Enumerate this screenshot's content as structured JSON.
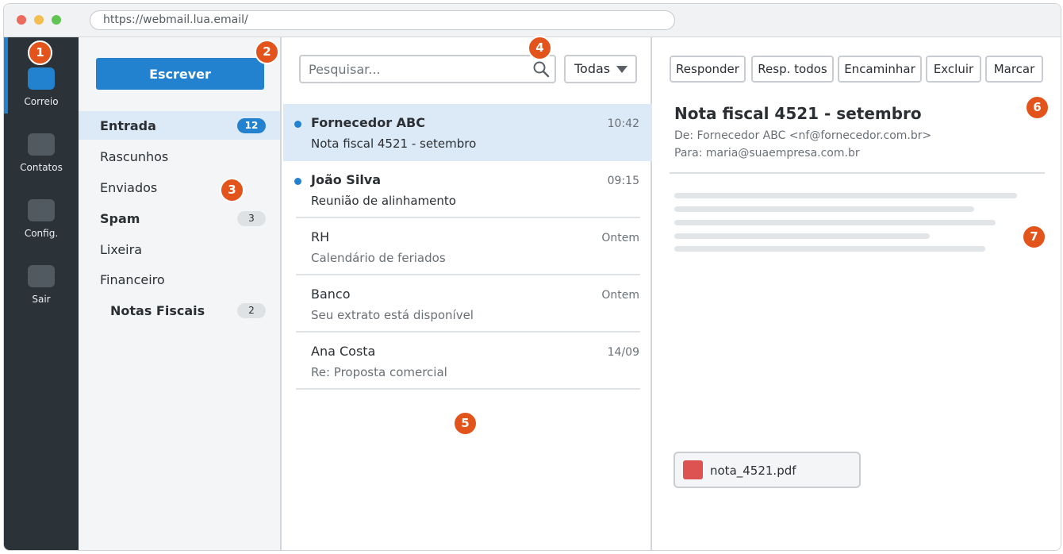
{
  "browser": {
    "url": "https://webmail.lua.email/"
  },
  "rail": {
    "items": [
      {
        "label": "Correio",
        "active": true
      },
      {
        "label": "Contatos"
      },
      {
        "label": "Config."
      },
      {
        "label": "Sair"
      }
    ]
  },
  "folders": {
    "compose_label": "Escrever",
    "items": [
      {
        "label": "Entrada",
        "badge": "12",
        "active": true,
        "bold": true
      },
      {
        "label": "Rascunhos"
      },
      {
        "label": "Enviados"
      },
      {
        "label": "Spam",
        "badge": "3",
        "bold": true
      },
      {
        "label": "Lixeira"
      },
      {
        "label": "Financeiro"
      },
      {
        "label": "Notas Fiscais",
        "badge": "2",
        "bold": true,
        "sub": true
      }
    ]
  },
  "list": {
    "search_placeholder": "Pesquisar...",
    "filter_label": "Todas",
    "messages": [
      {
        "sender": "Fornecedor ABC",
        "subject": "Nota fiscal 4521 - setembro",
        "time": "10:42",
        "unread": true,
        "selected": true
      },
      {
        "sender": "João Silva",
        "subject": "Reunião de alinhamento",
        "time": "09:15",
        "unread": true
      },
      {
        "sender": "RH",
        "subject": "Calendário de feriados",
        "time": "Ontem"
      },
      {
        "sender": "Banco",
        "subject": "Seu extrato está disponível",
        "time": "Ontem"
      },
      {
        "sender": "Ana Costa",
        "subject": "Re: Proposta comercial",
        "time": "14/09"
      }
    ]
  },
  "reader": {
    "toolbar": {
      "reply": "Responder",
      "reply_all": "Resp. todos",
      "forward": "Encaminhar",
      "delete": "Excluir",
      "mark": "Marcar"
    },
    "subject": "Nota fiscal 4521 - setembro",
    "from": "De: Fornecedor ABC <nf@fornecedor.com.br>",
    "to": "Para: maria@suaempresa.com.br",
    "attachment": "nota_4521.pdf"
  },
  "callouts": [
    "1",
    "2",
    "3",
    "4",
    "5",
    "6",
    "7"
  ],
  "colors": {
    "accent": "#2382cf",
    "rail_bg": "#2c3338",
    "selected_bg": "#dceaf7",
    "callout": "#e3541c",
    "pdf": "#dd5351"
  }
}
